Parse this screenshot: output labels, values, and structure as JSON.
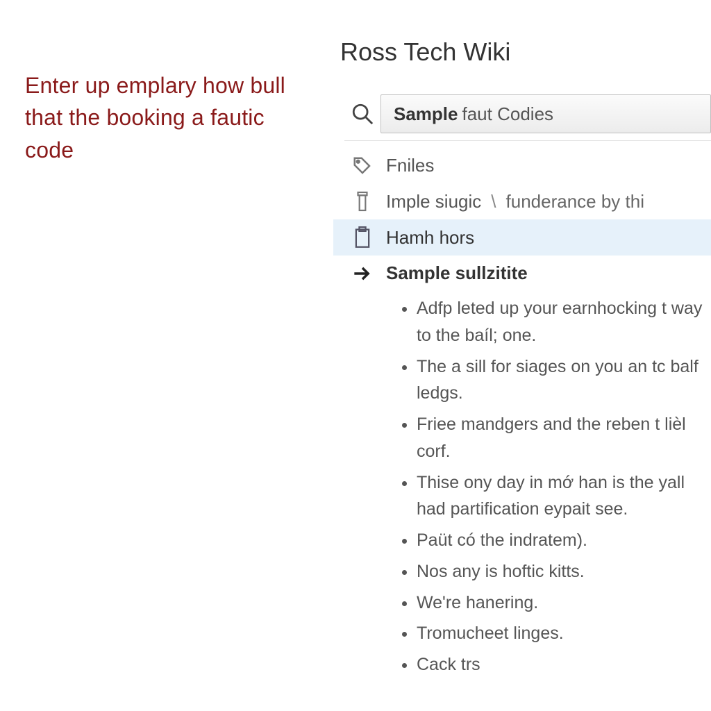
{
  "annotation": "Enter up emplary how bull that the booking a fautic code",
  "wiki": {
    "title": "Ross Tech Wiki",
    "search_bold": "Sample",
    "search_rest": "faut Codies",
    "items": [
      {
        "label": "Fniles"
      },
      {
        "label": "Imple siugic",
        "extra": "funderance by thi"
      },
      {
        "label": "Hamh hors"
      }
    ],
    "heading": "Sample sullzitite",
    "bullets": [
      "Adfp leted up your earnhocking t way to the baíl; one.",
      "The a sill for siages on you an tc balf ledgs.",
      "Friee mandgers and the reben t lièl corf.",
      "Thise ony day in mớ han is the yall had partification eypait see.",
      "Paüt có the indratem).",
      "Nos any is hoftic kitts.",
      "We're hanering.",
      "Tromucheet linges.",
      "Cack trs"
    ]
  }
}
